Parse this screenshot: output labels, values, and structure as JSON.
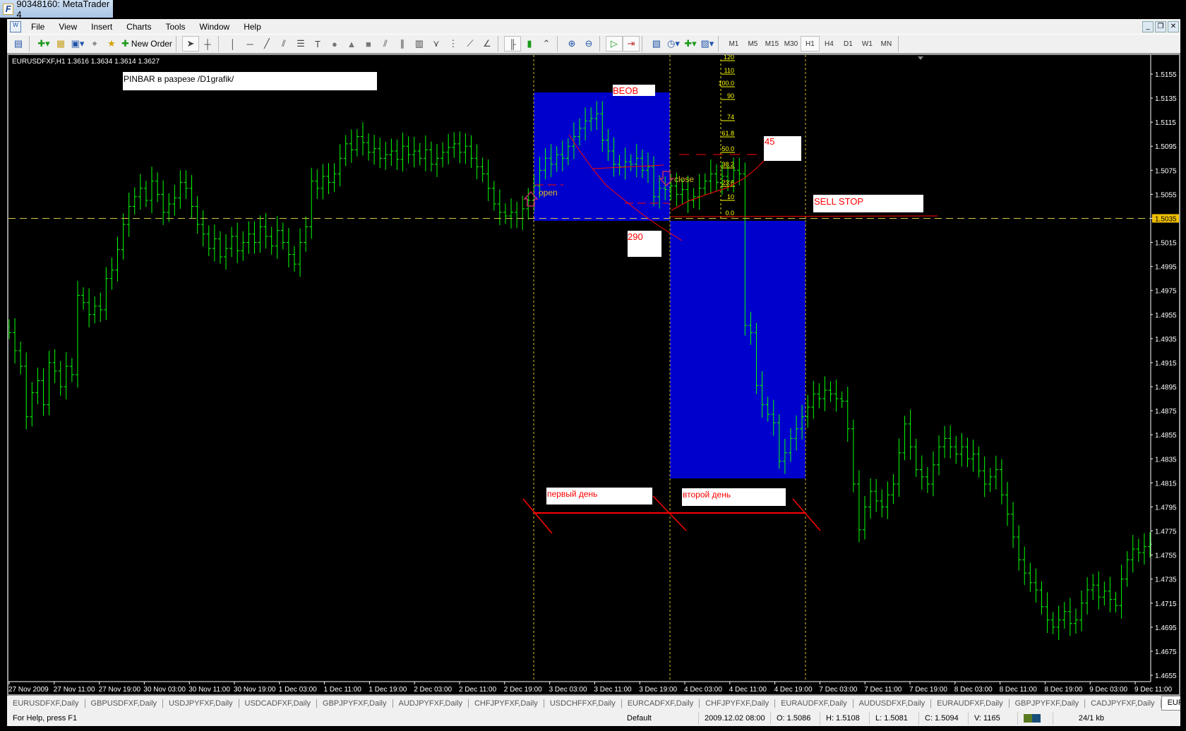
{
  "window": {
    "title": "90348160: MetaTrader 4",
    "logo": "F"
  },
  "menu": [
    "File",
    "View",
    "Insert",
    "Charts",
    "Tools",
    "Window",
    "Help"
  ],
  "window_buttons": [
    "minimize-icon",
    "restore-icon",
    "close-icon"
  ],
  "toolbar": {
    "new_order_label": "New Order",
    "timeframes": [
      "M1",
      "M5",
      "M15",
      "M30",
      "H1",
      "H4",
      "D1",
      "W1",
      "MN"
    ],
    "active_timeframe": "H1"
  },
  "chart": {
    "header": "EURUSDFXF,H1  1.3616 1.3634 1.3614 1.3627",
    "bar_color": "#00ff00",
    "bid_line_color": "#d4c84a",
    "rect_color": "#0000cc",
    "annotation_color": "#ff0000",
    "labels": {
      "pinbar": "PINBAR в разрезе /D1grafik/",
      "beob": "BEOB",
      "value45": "45",
      "sell_stop": "SELL STOP",
      "value290": "290",
      "first_day": "первый день",
      "second_day": "второй день",
      "open": "open",
      "close": "close"
    },
    "fibo_levels": [
      "120",
      "110",
      "100.0",
      "90",
      "74",
      "61.8",
      "50.0",
      "38.2",
      "23.6",
      "10",
      "0.0"
    ]
  },
  "chart_data": {
    "type": "bar",
    "symbol": "EURUSDFXF",
    "timeframe": "H1",
    "current_price": "1.5035",
    "ylim": [
      1.4655,
      1.5155
    ],
    "yticks": [
      "1.5155",
      "1.5135",
      "1.5115",
      "1.5095",
      "1.5075",
      "1.5055",
      "1.5035",
      "1.5015",
      "1.4995",
      "1.4975",
      "1.4955",
      "1.4935",
      "1.4915",
      "1.4895",
      "1.4875",
      "1.4855",
      "1.4835",
      "1.4815",
      "1.4795",
      "1.4775",
      "1.4755",
      "1.4735",
      "1.4715",
      "1.4695",
      "1.4675",
      "1.4655"
    ],
    "xticks": [
      "27 Nov 2009",
      "27 Nov 11:00",
      "27 Nov 19:00",
      "30 Nov 03:00",
      "30 Nov 11:00",
      "30 Nov 19:00",
      "1 Dec 03:00",
      "1 Dec 11:00",
      "1 Dec 19:00",
      "2 Dec 03:00",
      "2 Dec 11:00",
      "2 Dec 19:00",
      "3 Dec 03:00",
      "3 Dec 11:00",
      "3 Dec 19:00",
      "4 Dec 03:00",
      "4 Dec 11:00",
      "4 Dec 19:00",
      "7 Dec 03:00",
      "7 Dec 11:00",
      "7 Dec 19:00",
      "8 Dec 03:00",
      "8 Dec 11:00",
      "8 Dec 19:00",
      "9 Dec 03:00",
      "9 Dec 11:00"
    ],
    "close": [
      1.494,
      1.4925,
      1.4912,
      1.487,
      1.489,
      1.49,
      1.488,
      1.4915,
      1.4908,
      1.4895,
      1.4912,
      1.4905,
      1.4971,
      1.4965,
      1.4955,
      1.4962,
      1.4959,
      1.4985,
      1.4992,
      1.5009,
      1.503,
      1.5045,
      1.5053,
      1.506,
      1.505,
      1.5066,
      1.5055,
      1.504,
      1.5047,
      1.5052,
      1.5065,
      1.506,
      1.5045,
      1.503,
      1.5022,
      1.501,
      1.5018,
      1.5003,
      1.501,
      1.502,
      1.5008,
      1.5015,
      1.5022,
      1.5015,
      1.5028,
      1.502,
      1.5012,
      1.5025,
      1.5015,
      1.5005,
      1.4997,
      1.5015,
      1.5028,
      1.5066,
      1.506,
      1.507,
      1.5065,
      1.5072,
      1.5085,
      1.5097,
      1.5092,
      1.5103,
      1.5098,
      1.509,
      1.5093,
      1.5085,
      1.5088,
      1.5091,
      1.5084,
      1.5095,
      1.5088,
      1.5091,
      1.5085,
      1.5092,
      1.508,
      1.5085,
      1.509,
      1.5094,
      1.5097,
      1.509,
      1.5095,
      1.5085,
      1.5078,
      1.5072,
      1.506,
      1.5047,
      1.504,
      1.5037,
      1.504,
      1.5035,
      1.5043,
      1.505,
      1.5062,
      1.5075,
      1.5085,
      1.508,
      1.5088,
      1.5085,
      1.5095,
      1.5103,
      1.511,
      1.5116,
      1.5118,
      1.5122,
      1.51,
      1.5091,
      1.508,
      1.5078,
      1.5082,
      1.508,
      1.5085,
      1.5075,
      1.5078,
      1.5053,
      1.506,
      1.5059,
      1.5062,
      1.5055,
      1.5059,
      1.505,
      1.5053,
      1.506,
      1.5066,
      1.5072,
      1.5065,
      1.507,
      1.5066,
      1.5075,
      1.5072,
      1.4946,
      1.494,
      1.4896,
      1.488,
      1.4872,
      1.4865,
      1.4833,
      1.484,
      1.4852,
      1.486,
      1.487,
      1.4878,
      1.4889,
      1.4885,
      1.4892,
      1.4889,
      1.4885,
      1.4883,
      1.486,
      1.4814,
      1.4776,
      1.4795,
      1.4808,
      1.48,
      1.4795,
      1.4805,
      1.4814,
      1.484,
      1.4864,
      1.4845,
      1.4826,
      1.482,
      1.4814,
      1.483,
      1.4845,
      1.4852,
      1.4845,
      1.4839,
      1.4845,
      1.4835,
      1.4839,
      1.4825,
      1.4814,
      1.482,
      1.4826,
      1.4805,
      1.4789,
      1.477,
      1.4751,
      1.474,
      1.4732,
      1.4726,
      1.4712,
      1.4701,
      1.4695,
      1.4701,
      1.4708,
      1.4698,
      1.4701,
      1.4715,
      1.4726,
      1.473,
      1.472,
      1.4725,
      1.4718,
      1.4713,
      1.4735,
      1.4751,
      1.476,
      1.4757,
      1.4762,
      1.4764
    ]
  },
  "tabs": [
    "EURUSDFXF,Daily",
    "GBPUSDFXF,Daily",
    "USDJPYFXF,Daily",
    "USDCADFXF,Daily",
    "GBPJPYFXF,Daily",
    "AUDJPYFXF,Daily",
    "CHFJPYFXF,Daily",
    "USDCHFFXF,Daily",
    "EURCADFXF,Daily",
    "CHFJPYFXF,Daily",
    "EURAUDFXF,Daily",
    "AUDUSDFXF,Daily",
    "EURAUDFXF,Daily",
    "GBPJPYFXF,Daily",
    "CADJPYFXF,Daily",
    "EURU"
  ],
  "status": {
    "help": "For Help, press F1",
    "profile": "Default",
    "datetime": "2009.12.02 08:00",
    "open": "O: 1.5086",
    "high": "H: 1.5108",
    "low": "L: 1.5081",
    "close": "C: 1.5094",
    "volume": "V: 1165",
    "traffic": "24/1 kb"
  }
}
